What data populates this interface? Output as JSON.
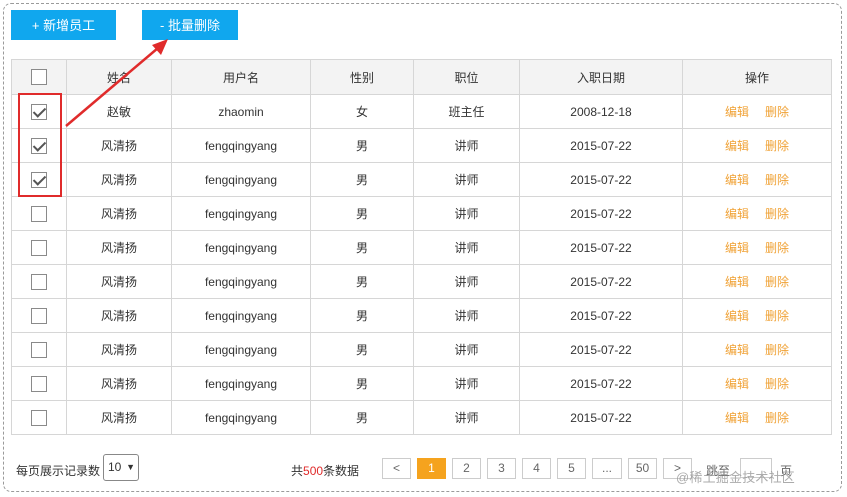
{
  "toolbar": {
    "add_label": "+ 新增员工",
    "batch_delete_label": "- 批量删除"
  },
  "table": {
    "headers": {
      "name": "姓名",
      "username": "用户名",
      "gender": "性别",
      "position": "职位",
      "hire_date": "入职日期",
      "actions": "操作"
    },
    "edit_label": "编辑",
    "delete_label": "删除",
    "rows": [
      {
        "checked": true,
        "name": "赵敏",
        "username": "zhaomin",
        "gender": "女",
        "position": "班主任",
        "hire_date": "2008-12-18"
      },
      {
        "checked": true,
        "name": "风清扬",
        "username": "fengqingyang",
        "gender": "男",
        "position": "讲师",
        "hire_date": "2015-07-22"
      },
      {
        "checked": true,
        "name": "风清扬",
        "username": "fengqingyang",
        "gender": "男",
        "position": "讲师",
        "hire_date": "2015-07-22"
      },
      {
        "checked": false,
        "name": "风清扬",
        "username": "fengqingyang",
        "gender": "男",
        "position": "讲师",
        "hire_date": "2015-07-22"
      },
      {
        "checked": false,
        "name": "风清扬",
        "username": "fengqingyang",
        "gender": "男",
        "position": "讲师",
        "hire_date": "2015-07-22"
      },
      {
        "checked": false,
        "name": "风清扬",
        "username": "fengqingyang",
        "gender": "男",
        "position": "讲师",
        "hire_date": "2015-07-22"
      },
      {
        "checked": false,
        "name": "风清扬",
        "username": "fengqingyang",
        "gender": "男",
        "position": "讲师",
        "hire_date": "2015-07-22"
      },
      {
        "checked": false,
        "name": "风清扬",
        "username": "fengqingyang",
        "gender": "男",
        "position": "讲师",
        "hire_date": "2015-07-22"
      },
      {
        "checked": false,
        "name": "风清扬",
        "username": "fengqingyang",
        "gender": "男",
        "position": "讲师",
        "hire_date": "2015-07-22"
      },
      {
        "checked": false,
        "name": "风清扬",
        "username": "fengqingyang",
        "gender": "男",
        "position": "讲师",
        "hire_date": "2015-07-22"
      }
    ]
  },
  "footer": {
    "page_size_label": "每页展示记录数",
    "page_size_value": "10",
    "total_prefix": "共",
    "total_count": "500",
    "total_suffix": "条数据",
    "pages": [
      "<",
      "1",
      "2",
      "3",
      "4",
      "5",
      "...",
      "50",
      ">"
    ],
    "current_page": "1",
    "goto_label": "跳至",
    "goto_suffix": "页"
  },
  "watermark": "@稀土掘金技术社区",
  "colors": {
    "primary_button": "#10a7ee",
    "action_link": "#f0a236",
    "active_page": "#f5a31e",
    "annotation_red": "#e02b2b"
  }
}
